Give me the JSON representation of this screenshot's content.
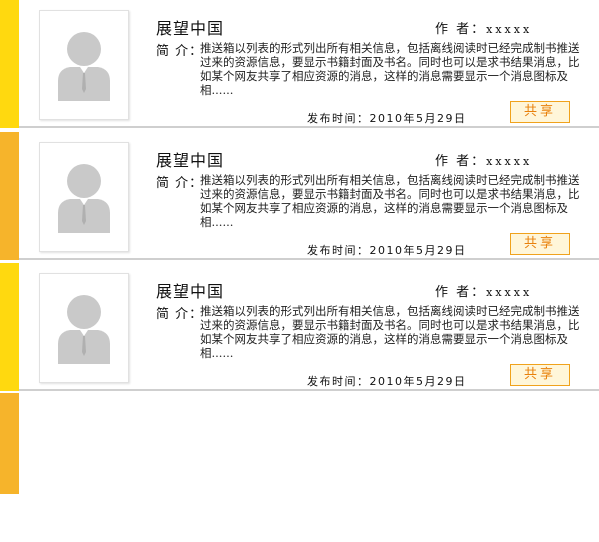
{
  "colors": {
    "bar_yellow": "#ffd90f",
    "bar_orange": "#f6b42b",
    "share_border": "#f0a21c",
    "share_bg": "#fff6d9",
    "share_text": "#e8810c"
  },
  "items": [
    {
      "title": "展望中国",
      "author_label": "作 者：",
      "author_value": "xxxxx",
      "intro_label": "简 介：",
      "intro_text": "推送箱以列表的形式列出所有相关信息，包括离线阅读时已经完成制书推送过来的资源信息，要显示书籍封面及书名。同时也可以是求书结果消息，比如某个网友共享了相应资源的消息，这样的消息需要显示一个消息图标及相......",
      "date": "发布时间：2010年5月29日",
      "share_label": "共享",
      "avatar_icon": "user-silhouette-icon"
    },
    {
      "title": "展望中国",
      "author_label": "作 者：",
      "author_value": "xxxxx",
      "intro_label": "简 介：",
      "intro_text": "推送箱以列表的形式列出所有相关信息，包括离线阅读时已经完成制书推送过来的资源信息，要显示书籍封面及书名。同时也可以是求书结果消息，比如某个网友共享了相应资源的消息，这样的消息需要显示一个消息图标及相......",
      "date": "发布时间：2010年5月29日",
      "share_label": "共享",
      "avatar_icon": "user-silhouette-icon"
    },
    {
      "title": "展望中国",
      "author_label": "作 者：",
      "author_value": "xxxxx",
      "intro_label": "简 介：",
      "intro_text": "推送箱以列表的形式列出所有相关信息，包括离线阅读时已经完成制书推送过来的资源信息，要显示书籍封面及书名。同时也可以是求书结果消息，比如某个网友共享了相应资源的消息，这样的消息需要显示一个消息图标及相......",
      "date": "发布时间：2010年5月29日",
      "share_label": "共享",
      "avatar_icon": "user-silhouette-icon"
    }
  ]
}
